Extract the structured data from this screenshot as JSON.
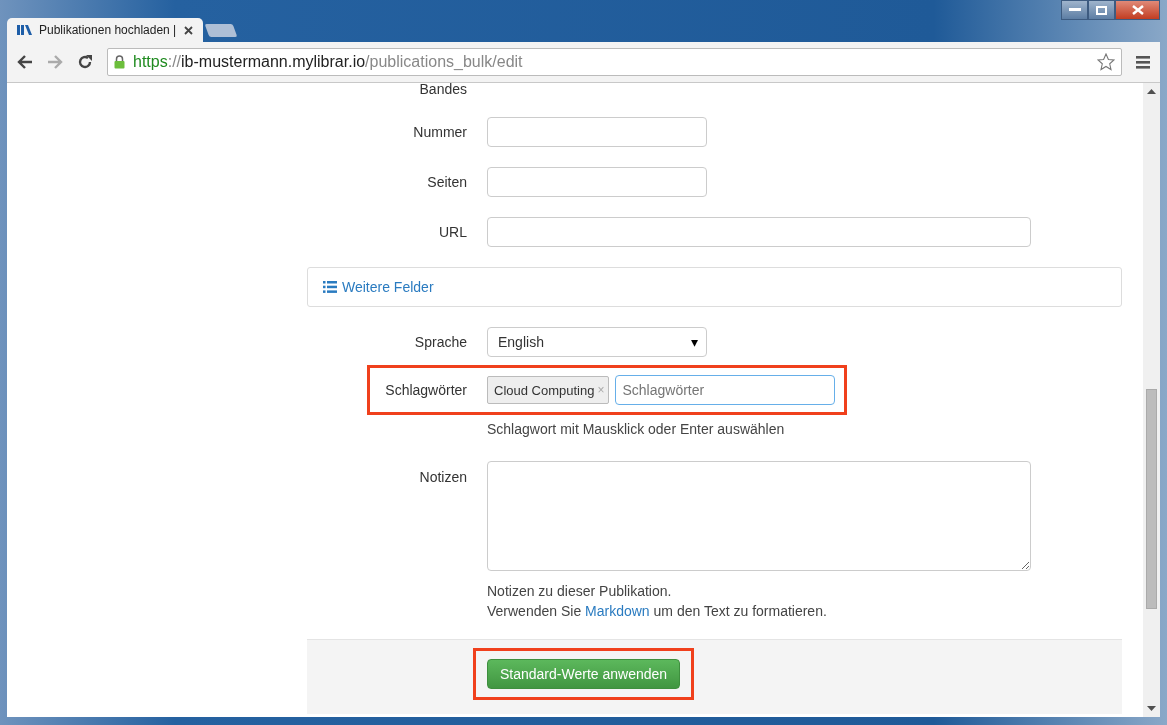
{
  "browser": {
    "tab_title": "Publikationen hochladen |",
    "url_scheme": "https",
    "url_separator": "://",
    "url_host": "ib-mustermann.mylibrar.io",
    "url_path": "/publications_bulk/edit"
  },
  "form": {
    "partial_label": "Bandes",
    "fields": [
      {
        "kind": "short",
        "label": "Nummer"
      },
      {
        "kind": "short",
        "label": "Seiten"
      },
      {
        "kind": "long",
        "label": "URL"
      }
    ],
    "more_fields": "Weitere Felder",
    "language": {
      "label": "Sprache",
      "value": "English",
      "caret": "▾"
    },
    "keywords": {
      "label": "Schlagwörter",
      "highlighted": true,
      "tags": [
        {
          "text": "Cloud Computing",
          "remove": "×"
        }
      ],
      "placeholder": "Schlagwörter",
      "help": "Schlagwort mit Mausklick oder Enter auswählen"
    },
    "notes": {
      "label": "Notizen",
      "help_1": "Notizen zu dieser Publikation.",
      "help_2_before": "Verwenden Sie",
      "help_2_link": "Markdown",
      "help_2_after": "um den Text zu formatieren."
    },
    "submit": {
      "label": "Standard-Werte anwenden",
      "highlighted": true
    }
  }
}
